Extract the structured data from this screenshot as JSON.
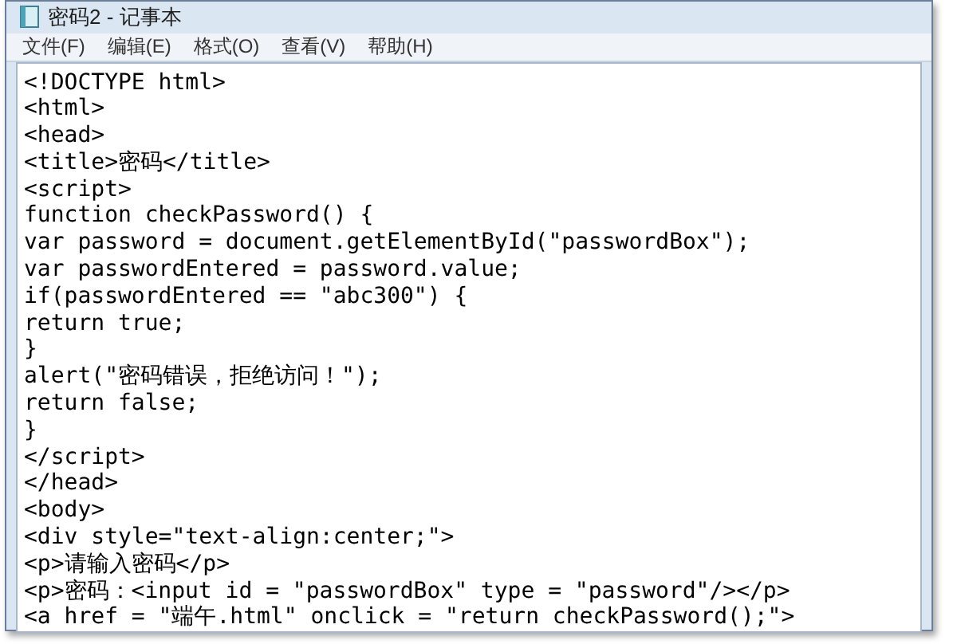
{
  "window": {
    "title": "密码2 - 记事本"
  },
  "menu": [
    "文件(F)",
    "编辑(E)",
    "格式(O)",
    "查看(V)",
    "帮助(H)"
  ],
  "editor": {
    "lines": [
      "<!DOCTYPE html>",
      "<html>",
      "<head>",
      "<title>密码</title>",
      "<script>",
      "function checkPassword() {",
      "var password = document.getElementById(\"passwordBox\");",
      "var passwordEntered = password.value;",
      "if(passwordEntered == \"abc300\") {",
      "return true;",
      "}",
      "alert(\"密码错误，拒绝访问！\");",
      "return false;",
      "}",
      "</script>",
      "</head>",
      "<body>",
      "<div style=\"text-align:center;\">",
      "<p>请输入密码</p>",
      "<p>密码：<input id = \"passwordBox\" type = \"password\"/></p>",
      "<a href = \"端午.html\" onclick = \"return checkPassword();\">"
    ]
  }
}
